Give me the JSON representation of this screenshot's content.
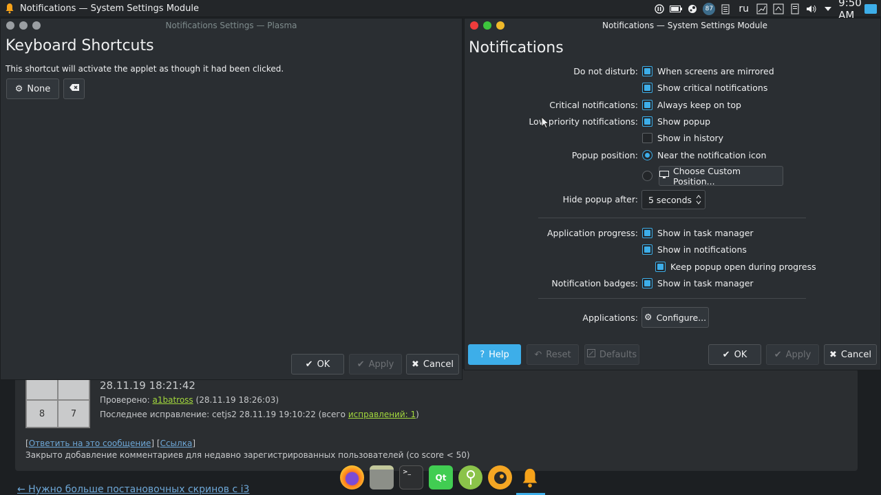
{
  "topbar": {
    "title": "Notifications — System Settings Module",
    "battery_badge": "87",
    "lang": "ru",
    "clock": "9:50 AM"
  },
  "left_window": {
    "title": "Notifications Settings — Plasma",
    "heading": "Keyboard Shortcuts",
    "description": "This shortcut will activate the applet as though it had been clicked.",
    "shortcut_label": "None",
    "ok_label": "OK",
    "apply_label": "Apply",
    "cancel_label": "Cancel"
  },
  "right_window": {
    "title": "Notifications — System Settings Module",
    "heading": "Notifications",
    "rows": {
      "dnd_label": "Do not disturb:",
      "dnd_mirrored": "When screens are mirrored",
      "dnd_critical": "Show critical notifications",
      "critical_label": "Critical notifications:",
      "critical_keep_top": "Always keep on top",
      "low_label": "Low priority notifications:",
      "low_popup": "Show popup",
      "low_history": "Show in history",
      "popup_pos_label": "Popup position:",
      "popup_near": "Near the notification icon",
      "popup_custom": "Choose Custom Position...",
      "hide_after_label": "Hide popup after:",
      "hide_after_value": "5 seconds",
      "progress_label": "Application progress:",
      "progress_task": "Show in task manager",
      "progress_notif": "Show in notifications",
      "progress_keep": "Keep popup open during progress",
      "badges_label": "Notification badges:",
      "badges_task": "Show in task manager",
      "apps_label": "Applications:",
      "apps_configure": "Configure..."
    },
    "buttons": {
      "help": "Help",
      "reset": "Reset",
      "defaults": "Defaults",
      "ok": "OK",
      "apply": "Apply",
      "cancel": "Cancel"
    },
    "checks": {
      "dnd_mirrored": true,
      "dnd_critical": true,
      "critical_keep_top": true,
      "low_popup": true,
      "low_history": false,
      "progress_task": true,
      "progress_notif": true,
      "progress_keep": true,
      "badges_task": true
    }
  },
  "webpage": {
    "date": "28.11.19 18:21:42",
    "checked_prefix": "Проверено:",
    "checked_user": "a1batross",
    "checked_time": "(28.11.19 18:26:03)",
    "last_fix": "Последнее исправление: cetjs2 28.11.19 19:10:22 (всего",
    "last_fix_link": "исправлений: 1",
    "last_fix_end": ")",
    "reply": "Ответить на это сообщение",
    "link": "Ссылка",
    "closed": "Закрыто добавление комментариев для недавно зарегистрированных пользователей (со score < 50)",
    "prev": "← Нужно больше постановочных скринов с i3",
    "keypad": [
      "8",
      "7"
    ]
  },
  "colors": {
    "accent": "#3daee9",
    "window_bg": "#2a2e32",
    "link_green": "#a3d83d"
  }
}
